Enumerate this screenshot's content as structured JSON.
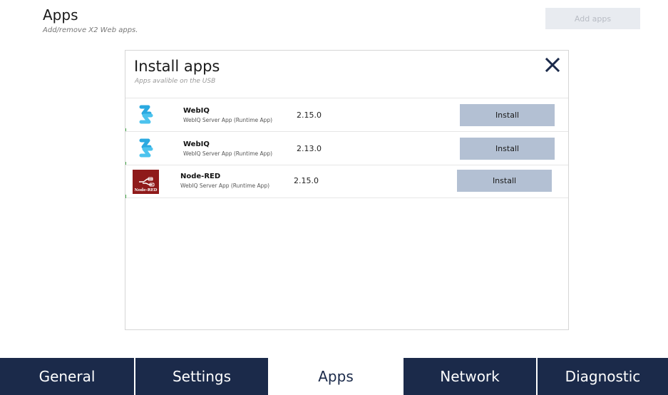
{
  "header": {
    "title": "Apps",
    "subtitle": "Add/remove X2 Web apps.",
    "add_apps_label": "Add apps"
  },
  "dialog": {
    "title": "Install apps",
    "subtitle": "Apps avalible on the USB",
    "close_icon": "close-icon",
    "apps": [
      {
        "name": "WebIQ",
        "description": "WebIQ Server App (Runtime App)",
        "version": "2.15.0",
        "install_label": "Install",
        "icon": "webiq-logo-icon"
      },
      {
        "name": "WebIQ",
        "description": "WebIQ Server App (Runtime App)",
        "version": "2.13.0",
        "install_label": "Install",
        "icon": "webiq-logo-icon"
      },
      {
        "name": "Node-RED",
        "description": "WebIQ Server App (Runtime App)",
        "version": "2.15.0",
        "install_label": "Install",
        "icon": "node-red-logo-icon",
        "icon_text": "Node-RED"
      }
    ]
  },
  "tabs": [
    {
      "label": "General",
      "active": false
    },
    {
      "label": "Settings",
      "active": false
    },
    {
      "label": "Apps",
      "active": true
    },
    {
      "label": "Network",
      "active": false
    },
    {
      "label": "Diagnostic",
      "active": false
    }
  ],
  "colors": {
    "nav_bg": "#1b2a4a",
    "install_button": "#b3c0d3",
    "webiq_blue": "#2aa9e0",
    "node_red": "#8f1a1a"
  }
}
